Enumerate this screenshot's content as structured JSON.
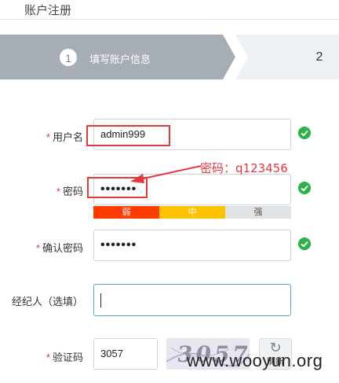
{
  "page": {
    "title": "账户注册"
  },
  "steps": [
    {
      "number": "1",
      "label": "填写账户信息",
      "active": true
    },
    {
      "number": "2",
      "label": "",
      "active": false
    }
  ],
  "form": {
    "required_mark": "*",
    "username": {
      "label": "用户名",
      "value": "admin999",
      "valid": true
    },
    "password": {
      "label": "密码",
      "value": "•••••••",
      "valid": true
    },
    "password_strength": {
      "weak": "弱",
      "medium": "中",
      "strong": "强",
      "level": "weak"
    },
    "confirm_password": {
      "label": "确认密码",
      "value": "•••••••",
      "valid": true
    },
    "agent": {
      "label": "经纪人（选填）",
      "value": ""
    },
    "captcha": {
      "label": "验证码",
      "value": "3057",
      "image_text": "3057",
      "refresh_label": "刷新"
    }
  },
  "annotation": {
    "text": "密码：q123456"
  },
  "watermark": {
    "text": "www.wooyun.org"
  },
  "colors": {
    "step_active": "#a6adb4",
    "step_inactive": "#eef1f4",
    "required": "#e4393c",
    "valid": "#2db24a",
    "weak": "#ff3b00",
    "medium": "#ffc200",
    "strong": "#e0e3e6",
    "annotation": "#e4393c"
  }
}
